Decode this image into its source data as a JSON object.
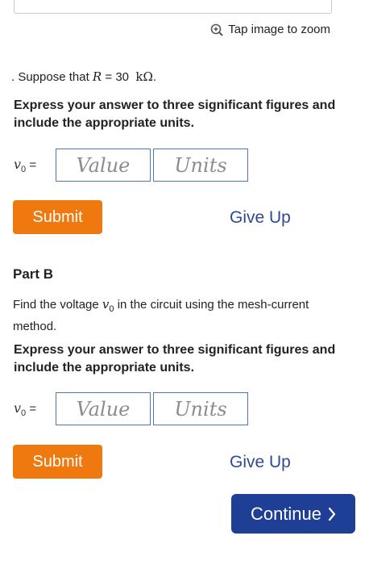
{
  "zoom": {
    "icon": "zoom-in-icon",
    "label": "Tap image to zoom"
  },
  "given": {
    "prefix": ". Suppose that",
    "variable": "R",
    "equals": "=",
    "value": "30",
    "unit": "kΩ",
    "suffix": "."
  },
  "part_a": {
    "instruction": "Express your answer to three significant figures and include the appropriate units.",
    "variable": "v",
    "subscript": "0",
    "equals": "=",
    "value_placeholder": "Value",
    "units_placeholder": "Units",
    "submit_label": "Submit",
    "giveup_label": "Give Up"
  },
  "part_b": {
    "title": "Part B",
    "question_prefix": "Find the voltage",
    "question_var": "v",
    "question_sub": "0",
    "question_suffix": "in the circuit using the mesh-current method.",
    "instruction": "Express your answer to three significant figures and include the appropriate units.",
    "variable": "v",
    "subscript": "0",
    "equals": "=",
    "value_placeholder": "Value",
    "units_placeholder": "Units",
    "submit_label": "Submit",
    "giveup_label": "Give Up"
  },
  "continue": {
    "label": "Continue",
    "icon": "chevron-right-icon"
  },
  "colors": {
    "submit": "#f0790f",
    "giveup": "#2c4b94",
    "continue": "#1f3e96",
    "field_border": "#4a78b8"
  }
}
